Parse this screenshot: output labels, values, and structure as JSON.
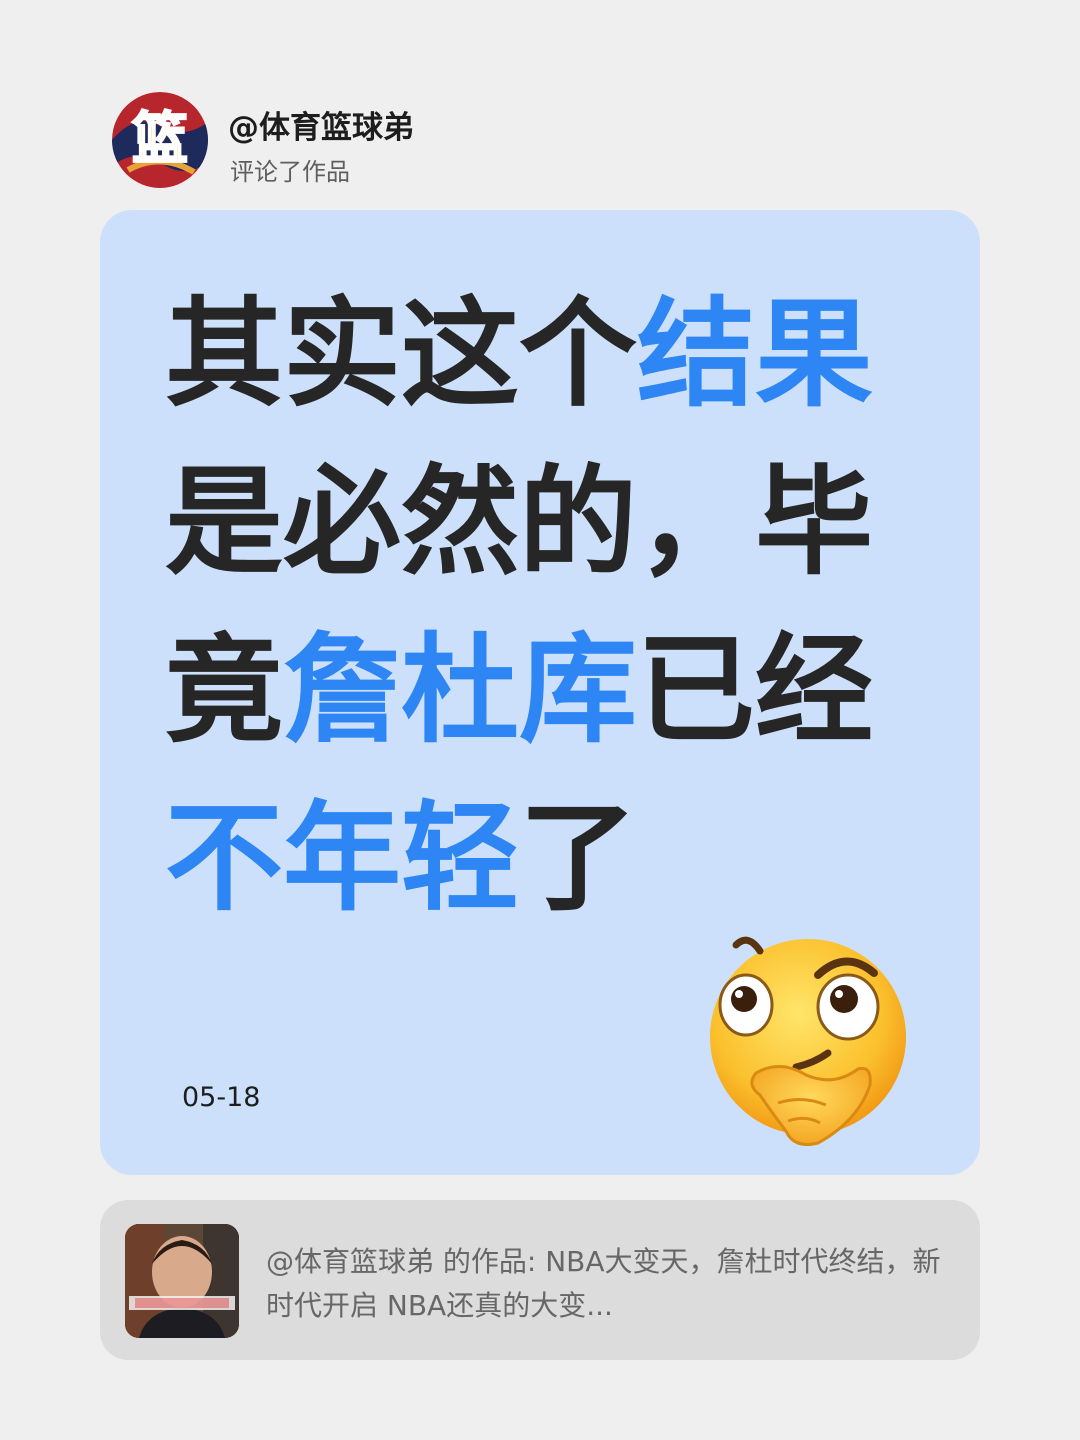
{
  "header": {
    "user_name": "@体育篮球弟",
    "action": "评论了作品",
    "avatar_icon": "basketball-logo-avatar",
    "avatar_glyph": "篮"
  },
  "comment": {
    "segments": [
      {
        "text": "其实这个",
        "highlight": false
      },
      {
        "text": "结果",
        "highlight": true
      },
      {
        "text": "是必然的，毕竟",
        "highlight": false
      },
      {
        "text": "詹杜库",
        "highlight": true
      },
      {
        "text": "已经",
        "highlight": false
      },
      {
        "text": "不年轻",
        "highlight": true
      },
      {
        "text": "了",
        "highlight": false
      }
    ],
    "date": "05-18",
    "emoji": "thinking-face-icon"
  },
  "reference": {
    "text": "@体育篮球弟 的作品: NBA大变天，詹杜时代终结，新时代开启 NBA还真的大变...",
    "thumbnail_icon": "video-thumbnail"
  },
  "colors": {
    "background": "#efefef",
    "card": "#cde0fb",
    "highlight": "#2d86f4",
    "text": "#262626",
    "ref_card": "#dcdcdc"
  }
}
